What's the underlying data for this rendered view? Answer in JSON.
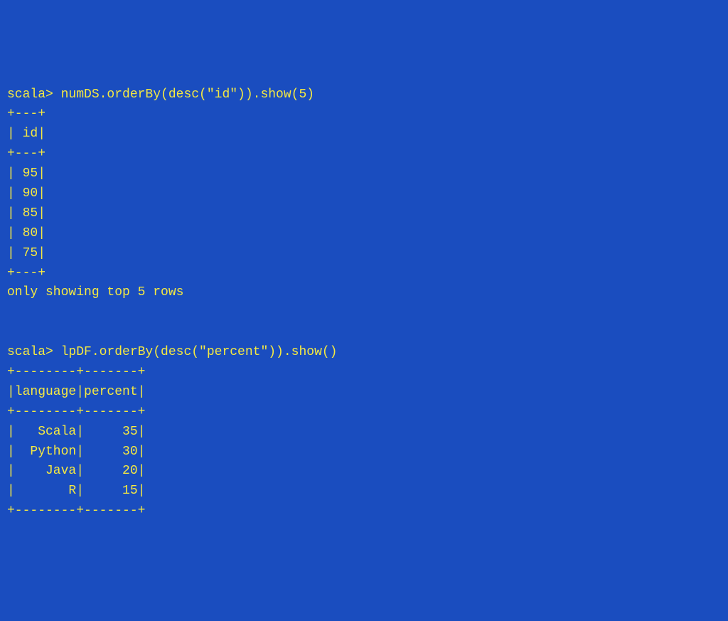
{
  "lines": [
    "scala> numDS.orderBy(desc(\"id\")).show(5)",
    "+---+",
    "| id|",
    "+---+",
    "| 95|",
    "| 90|",
    "| 85|",
    "| 80|",
    "| 75|",
    "+---+",
    "only showing top 5 rows",
    "",
    "",
    "scala> lpDF.orderBy(desc(\"percent\")).show()",
    "+--------+-------+",
    "|language|percent|",
    "+--------+-------+",
    "|   Scala|     35|",
    "|  Python|     30|",
    "|    Java|     20|",
    "|       R|     15|",
    "+--------+-------+"
  ],
  "chart_data": [
    {
      "type": "table",
      "title": "numDS ordered by id descending (top 5)",
      "columns": [
        "id"
      ],
      "rows": [
        [
          95
        ],
        [
          90
        ],
        [
          85
        ],
        [
          80
        ],
        [
          75
        ]
      ]
    },
    {
      "type": "table",
      "title": "lpDF ordered by percent descending",
      "columns": [
        "language",
        "percent"
      ],
      "rows": [
        [
          "Scala",
          35
        ],
        [
          "Python",
          30
        ],
        [
          "Java",
          20
        ],
        [
          "R",
          15
        ]
      ]
    }
  ]
}
